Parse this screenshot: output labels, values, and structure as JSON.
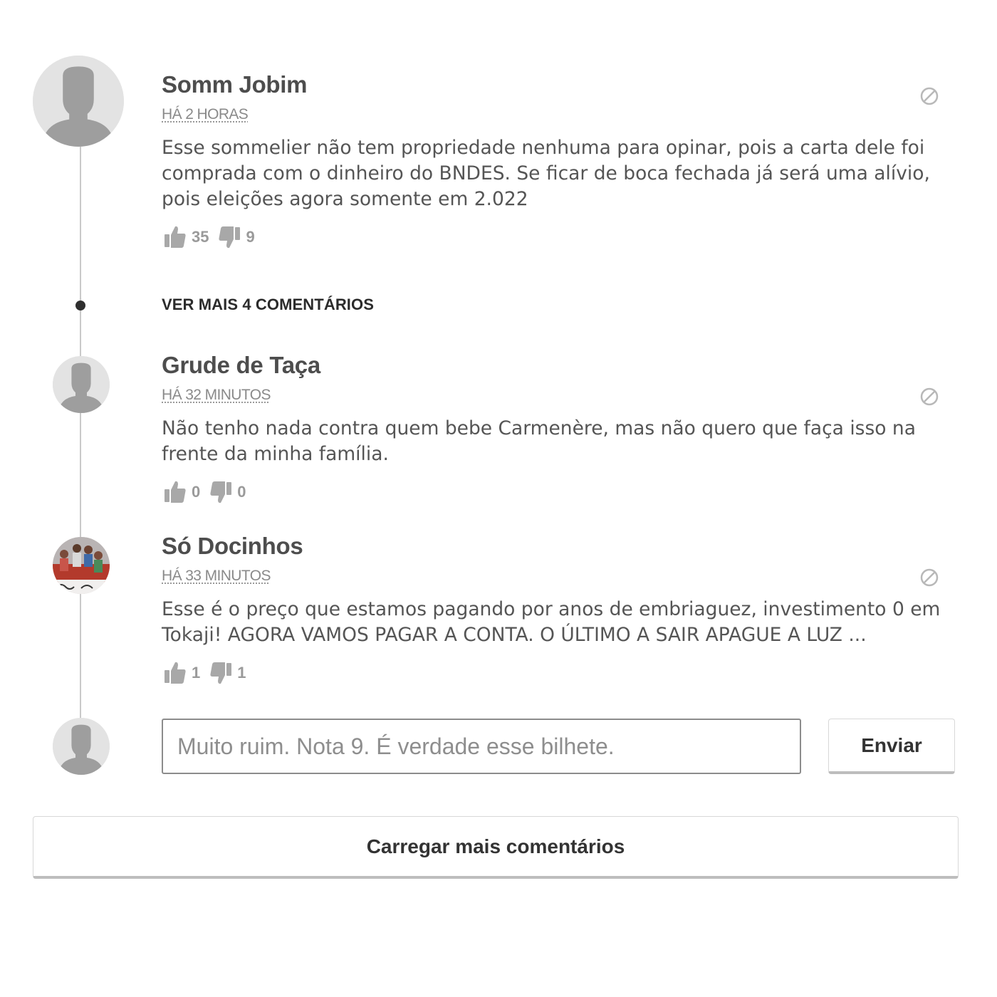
{
  "comments": [
    {
      "author": "Somm Jobim",
      "time": "HÁ 2 HORAS",
      "text": "Esse sommelier não tem propriedade nenhuma para opinar, pois a carta dele foi comprada com o dinheiro do BNDES. Se ficar de boca fechada já será uma alívio, pois eleições agora somente em 2.022",
      "likes": "35",
      "dislikes": "9",
      "avatar_icon": "default-user-silhouette"
    },
    {
      "author": "Grude de Taça",
      "time": "HÁ 32 MINUTOS",
      "text": "Não tenho nada contra quem bebe Carmenère, mas não quero que faça isso na frente da minha família.",
      "likes": "0",
      "dislikes": "0",
      "avatar_icon": "default-user-silhouette"
    },
    {
      "author": "Só Docinhos",
      "time": "HÁ 33 MINUTOS",
      "text": "Esse é o preço que estamos pagando por anos de embriaguez, investimento 0 em Tokaji! AGORA VAMOS PAGAR A CONTA. O ÚLTIMO A SAIR APAGUE A LUZ ...",
      "likes": "1",
      "dislikes": "1",
      "avatar_icon": "user-photo-group"
    }
  ],
  "see_more_replies": "VER MAIS 4 COMENTÁRIOS",
  "composer": {
    "value": "",
    "placeholder": "Muito ruim. Nota 9. É verdade esse bilhete.",
    "send_label": "Enviar",
    "avatar_icon": "default-user-silhouette"
  },
  "load_more_label": "Carregar mais comentários",
  "icons": {
    "like": "thumbs-up-icon",
    "dislike": "thumbs-down-icon",
    "report": "report-block-icon"
  },
  "colors": {
    "text": "#555555",
    "muted": "#9a9a9a",
    "thread_line": "#c9c9c9",
    "avatar_bg": "#e3e3e3",
    "avatar_silhouette": "#9e9e9e"
  }
}
